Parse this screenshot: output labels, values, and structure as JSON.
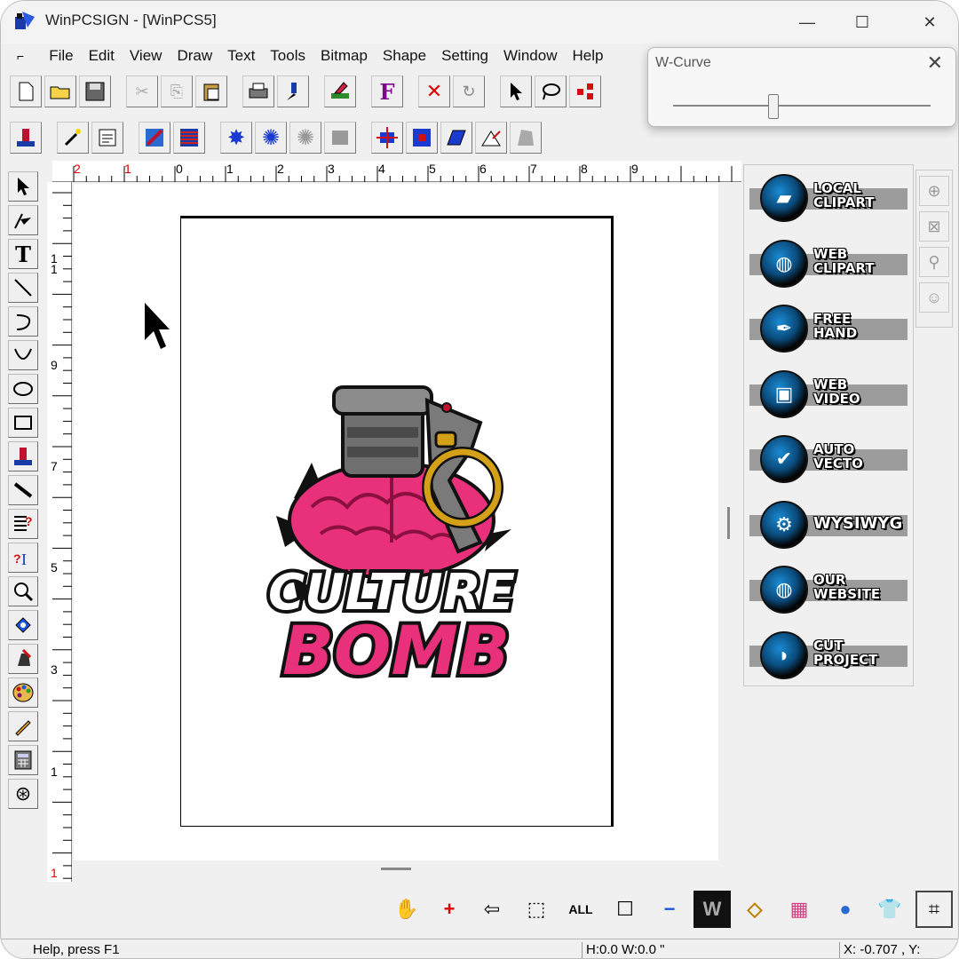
{
  "window": {
    "title": "WinPCSIGN - [WinPCS5]",
    "minimize_glyph": "—",
    "maximize_glyph": "☐",
    "close_glyph": "✕"
  },
  "menu": {
    "doc_icon": "document-icon",
    "items": [
      "File",
      "Edit",
      "View",
      "Draw",
      "Text",
      "Tools",
      "Bitmap",
      "Shape",
      "Setting",
      "Window",
      "Help"
    ]
  },
  "toolbar1": {
    "icons": [
      "new-file-icon",
      "open-folder-icon",
      "save-icon",
      "cut-icon",
      "copy-icon",
      "paste-icon",
      "print-icon",
      "plotter-icon",
      "eraser-icon",
      "font-icon",
      "delete-icon",
      "redo-icon",
      "select-arrow-icon",
      "lasso-icon",
      "node-icon"
    ]
  },
  "toolbar2": {
    "icons": [
      "stamp-icon",
      "magic-wand-icon",
      "scan-icon",
      "bitmap-trace-icon",
      "shade-icon",
      "weed-icon",
      "gear-outline-icon",
      "blur-icon",
      "block-icon",
      "cross-align-icon",
      "split-icon",
      "parallelogram-icon",
      "angle-icon",
      "shape-icon"
    ]
  },
  "lefttools": {
    "icons": [
      "pointer-icon",
      "node-edit-icon",
      "text-icon",
      "line-icon",
      "arc-icon",
      "bezier-icon",
      "ellipse-icon",
      "rectangle-icon",
      "stamp-icon",
      "knife-icon",
      "text-frame-icon",
      "text-path-icon",
      "zoom-icon",
      "fill-bucket-icon",
      "paint-icon",
      "palette-icon",
      "pencil-icon",
      "calculator-icon",
      "wheel-icon"
    ]
  },
  "ruler": {
    "top": [
      {
        "t": "2",
        "red": true
      },
      {
        "t": "1",
        "red": true
      },
      {
        "t": "0"
      },
      {
        "t": "1"
      },
      {
        "t": "2"
      },
      {
        "t": "3"
      },
      {
        "t": "4"
      },
      {
        "t": "5"
      },
      {
        "t": "6"
      },
      {
        "t": "7"
      },
      {
        "t": "8"
      },
      {
        "t": "9"
      }
    ],
    "left": [
      {
        "t": "1"
      },
      {
        "t": "1"
      },
      {
        "t": "9"
      },
      {
        "t": "7"
      },
      {
        "t": "5"
      },
      {
        "t": "3"
      },
      {
        "t": "1"
      },
      {
        "t": "1",
        "red": true
      }
    ]
  },
  "artwork": {
    "line1": "CULTURE",
    "line2": "BOMB",
    "pink": "#e8317a",
    "metal": "#6f6f6f",
    "gold": "#d4a017"
  },
  "sidepanel": {
    "items": [
      {
        "l1": "LOCAL",
        "l2": "CLIPART",
        "icon": "folder-icon"
      },
      {
        "l1": "WEB",
        "l2": "CLIPART",
        "icon": "globe-icon"
      },
      {
        "l1": "FREE",
        "l2": "HAND",
        "icon": "pen-nib-icon"
      },
      {
        "l1": "WEB",
        "l2": "VIDEO",
        "icon": "tv-icon"
      },
      {
        "l1": "AUTO",
        "l2": "VECTO",
        "icon": "checkmark-icon"
      },
      {
        "l1": "WYSIWYG",
        "l2": "",
        "icon": "gear-icon"
      },
      {
        "l1": "OUR",
        "l2": "WEBSITE",
        "icon": "globe-icon"
      },
      {
        "l1": "CUT",
        "l2": "PROJECT",
        "icon": "cut-shape-icon"
      }
    ]
  },
  "sidemini": {
    "icons": [
      "wheel-icon",
      "cross-icon",
      "magnifier-icon",
      "face-icon"
    ]
  },
  "bottombar": {
    "icons": [
      "hand-pan-icon",
      "zoom-in-icon",
      "zoom-back-icon",
      "zoom-selection-icon",
      "zoom-all-icon",
      "zoom-page-icon",
      "zoom-out-icon",
      "w-logo-icon",
      "c-logo-icon",
      "color-palette-icon",
      "earth-icon",
      "tshirt-icon",
      "crop-icon"
    ]
  },
  "status": {
    "help": "Help, press F1",
    "hw": "H:0.0   W:0.0 \"",
    "coords": "X: -0.707 , Y:"
  },
  "wcurve": {
    "title": "W-Curve",
    "close": "✕",
    "level": 0.39
  }
}
